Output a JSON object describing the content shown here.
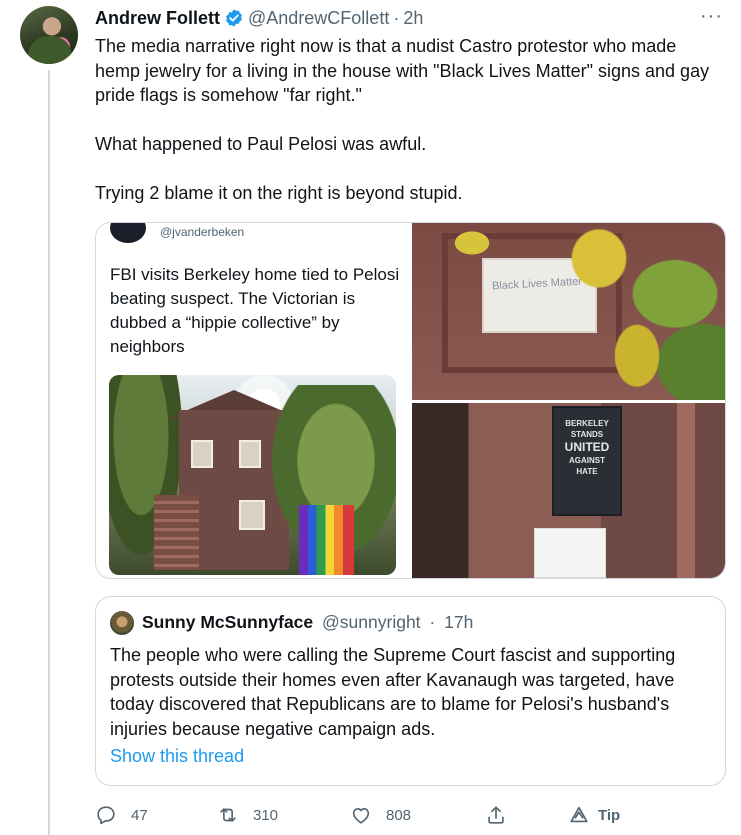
{
  "tweet": {
    "author": {
      "display_name": "Andrew Follett",
      "handle": "@AndrewCFollett",
      "separator": "·",
      "time": "2h",
      "verified": true
    },
    "more_label": "···",
    "text": {
      "para1": "The media narrative right now is that a nudist Castro protestor who made hemp jewelry for a living in the house with \"Black Lives Matter\" signs and gay pride flags is somehow \"far right.\"",
      "para2": "What happened to Paul Pelosi was awful.",
      "para3": "Trying 2 blame it on the right is beyond stupid."
    },
    "media": {
      "article": {
        "handle": "@jvanderbeken",
        "text": "FBI visits Berkeley home tied to Pelosi beating suspect. The Victorian is dubbed a “hippie collective” by neighbors"
      },
      "sign_text": "Black Lives Matter",
      "banner": {
        "line1": "BERKELEY",
        "line2": "STANDS",
        "line3": "UNITED",
        "line4": "AGAINST",
        "line5": "HATE"
      }
    },
    "quote": {
      "display_name": "Sunny McSunnyface",
      "handle": "@sunnyright",
      "separator": "·",
      "time": "17h",
      "text": "The people who were calling the Supreme Court fascist and supporting protests outside their homes even after Kavanaugh was targeted, have today discovered that Republicans are to blame for Pelosi's husband's injuries because negative campaign ads.",
      "show_thread": "Show this thread"
    },
    "actions": {
      "replies": "47",
      "retweets": "310",
      "likes": "808",
      "tip_label": "Tip"
    }
  },
  "colors": {
    "link": "#1d9bf0",
    "secondary_text": "#536471",
    "border": "#cfd9de",
    "verified": "#1d9bf0"
  },
  "icons": [
    "verified-badge-icon",
    "more-icon",
    "reply-icon",
    "retweet-icon",
    "like-icon",
    "share-icon",
    "tip-icon"
  ]
}
